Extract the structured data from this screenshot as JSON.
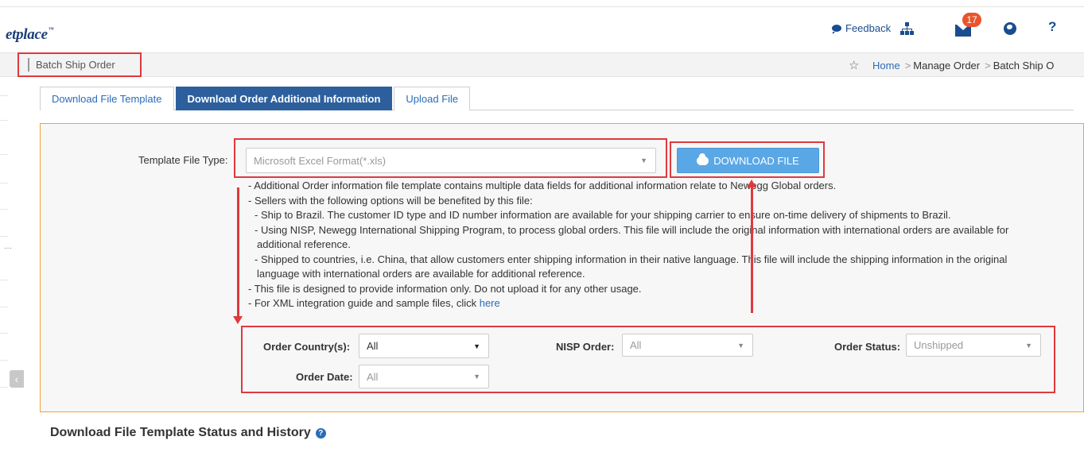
{
  "header": {
    "brand": "etplace",
    "brand_mark": "™",
    "feedback_label": "Feedback",
    "mail_count": "17",
    "help_label": "?"
  },
  "breadcrumb": {
    "page_title": "Batch Ship Order",
    "items": [
      "Home",
      "Manage Order",
      "Batch Ship O"
    ],
    "separator": ">"
  },
  "tabs": [
    {
      "label": "Download File Template",
      "active": false
    },
    {
      "label": "Download Order Additional Information",
      "active": true
    },
    {
      "label": "Upload File",
      "active": false
    }
  ],
  "form": {
    "template_type_label": "Template File Type:",
    "template_type_value": "Microsoft Excel Format(*.xls)",
    "download_button": "DOWNLOAD FILE",
    "info_lines": [
      "- Additional Order information file template contains multiple data fields for additional information relate to Newegg Global orders.",
      "- Sellers with the following options will be benefited by this file:",
      "- Ship to Brazil. The customer ID type and ID number information are available for your shipping carrier to ensure on-time delivery of shipments to Brazil.",
      "- Using NISP, Newegg International Shipping Program, to process global orders. This file will include the original information with international orders are available for",
      "additional reference.",
      "- Shipped to countries, i.e. China, that allow customers enter shipping information in their native language. This file will include the shipping information in the original",
      "language with international orders are available for additional reference.",
      "- This file is designed to provide information only. Do not upload it for any other usage.",
      "- For XML integration guide and sample files, click "
    ],
    "xml_link": "here",
    "filters": {
      "order_country_label": "Order Country(s):",
      "order_country_value": "All",
      "nisp_label": "NISP Order:",
      "nisp_value": "All",
      "order_status_label": "Order Status:",
      "order_status_value": "Unshipped",
      "order_date_label": "Order Date:",
      "order_date_value": "All"
    }
  },
  "section": {
    "title": "Download File Template Status and History"
  },
  "colors": {
    "accent": "#2d5f9d",
    "highlight": "#e0393e",
    "panel_border": "#f0a33a",
    "button": "#5aa7e6"
  }
}
